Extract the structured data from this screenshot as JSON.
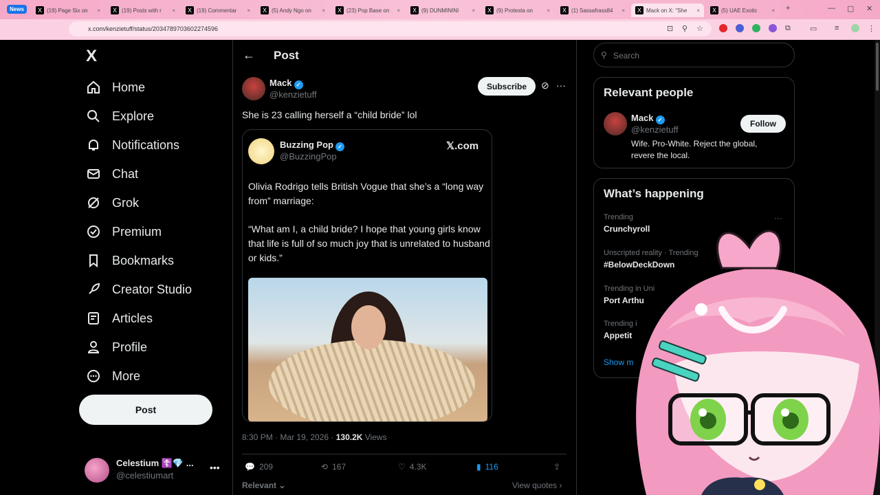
{
  "browser": {
    "news_badge": "News",
    "tabs": [
      {
        "title": "(19) Page Six on"
      },
      {
        "title": "(19) Posts with r"
      },
      {
        "title": "(19) Commentar"
      },
      {
        "title": "(5) Andy Ngo on"
      },
      {
        "title": "(23) Pop Base on"
      },
      {
        "title": "(9) DUNMININI"
      },
      {
        "title": "(9) Protesta on"
      },
      {
        "title": "(1) Sassafrass84"
      },
      {
        "title": "Mack on X: \"She"
      },
      {
        "title": "(5) UAE Exotic"
      }
    ],
    "url": "x.com/kenzietuff/status/2034789703602274596"
  },
  "sidebar": {
    "logo": "X",
    "items": [
      {
        "label": "Home",
        "icon": "home-icon"
      },
      {
        "label": "Explore",
        "icon": "search-icon"
      },
      {
        "label": "Notifications",
        "icon": "bell-icon"
      },
      {
        "label": "Chat",
        "icon": "mail-icon"
      },
      {
        "label": "Grok",
        "icon": "grok-icon"
      },
      {
        "label": "Premium",
        "icon": "premium-icon"
      },
      {
        "label": "Bookmarks",
        "icon": "bookmark-icon"
      },
      {
        "label": "Creator Studio",
        "icon": "rocket-icon"
      },
      {
        "label": "Articles",
        "icon": "article-icon"
      },
      {
        "label": "Profile",
        "icon": "profile-icon"
      },
      {
        "label": "More",
        "icon": "more-icon"
      }
    ],
    "post_button": "Post",
    "account": {
      "name": "Celestium ☦️💎 ...",
      "handle": "@celestiumart"
    }
  },
  "post": {
    "header": "Post",
    "author_name": "Mack",
    "author_handle": "@kenzietuff",
    "subscribe_label": "Subscribe",
    "text": "She is 23 calling herself a “child bride” lol",
    "quoted": {
      "name": "Buzzing Pop",
      "handle": "@BuzzingPop",
      "source": "𝕏.com",
      "paragraph1": "Olivia Rodrigo tells British Vogue that she’s a “long way from” marriage:",
      "paragraph2": "“What am I, a child bride? I hope that young girls know that life is full of so much joy that is unrelated to husband or kids.”"
    },
    "timestamp": "8:30 PM · Mar 19, 2026 · ",
    "views_count": "130.2K",
    "views_label": " Views",
    "replies": "209",
    "reposts": "167",
    "likes": "4.3K",
    "bookmarks": "116",
    "sort_label": "Relevant",
    "view_quotes": "View quotes"
  },
  "right": {
    "search_placeholder": "Search",
    "relevant_title": "Relevant people",
    "person_name": "Mack",
    "person_handle": "@kenzietuff",
    "follow_label": "Follow",
    "person_bio": "Wife. Pro-White. Reject the global, revere the local.",
    "happening_title": "What’s happening",
    "trends": [
      {
        "context": "Trending",
        "topic": "Crunchyroll"
      },
      {
        "context": "Unscripted reality · Trending",
        "topic": "#BelowDeckDown"
      },
      {
        "context": "Trending in Uni",
        "topic": "Port Arthu"
      },
      {
        "context": "Trending i",
        "topic": "Appetit"
      }
    ],
    "show_more": "Show m"
  },
  "colors": {
    "accent": "#1d9bf0",
    "background": "#000000",
    "chrome_pink": "#f7b3cf"
  }
}
